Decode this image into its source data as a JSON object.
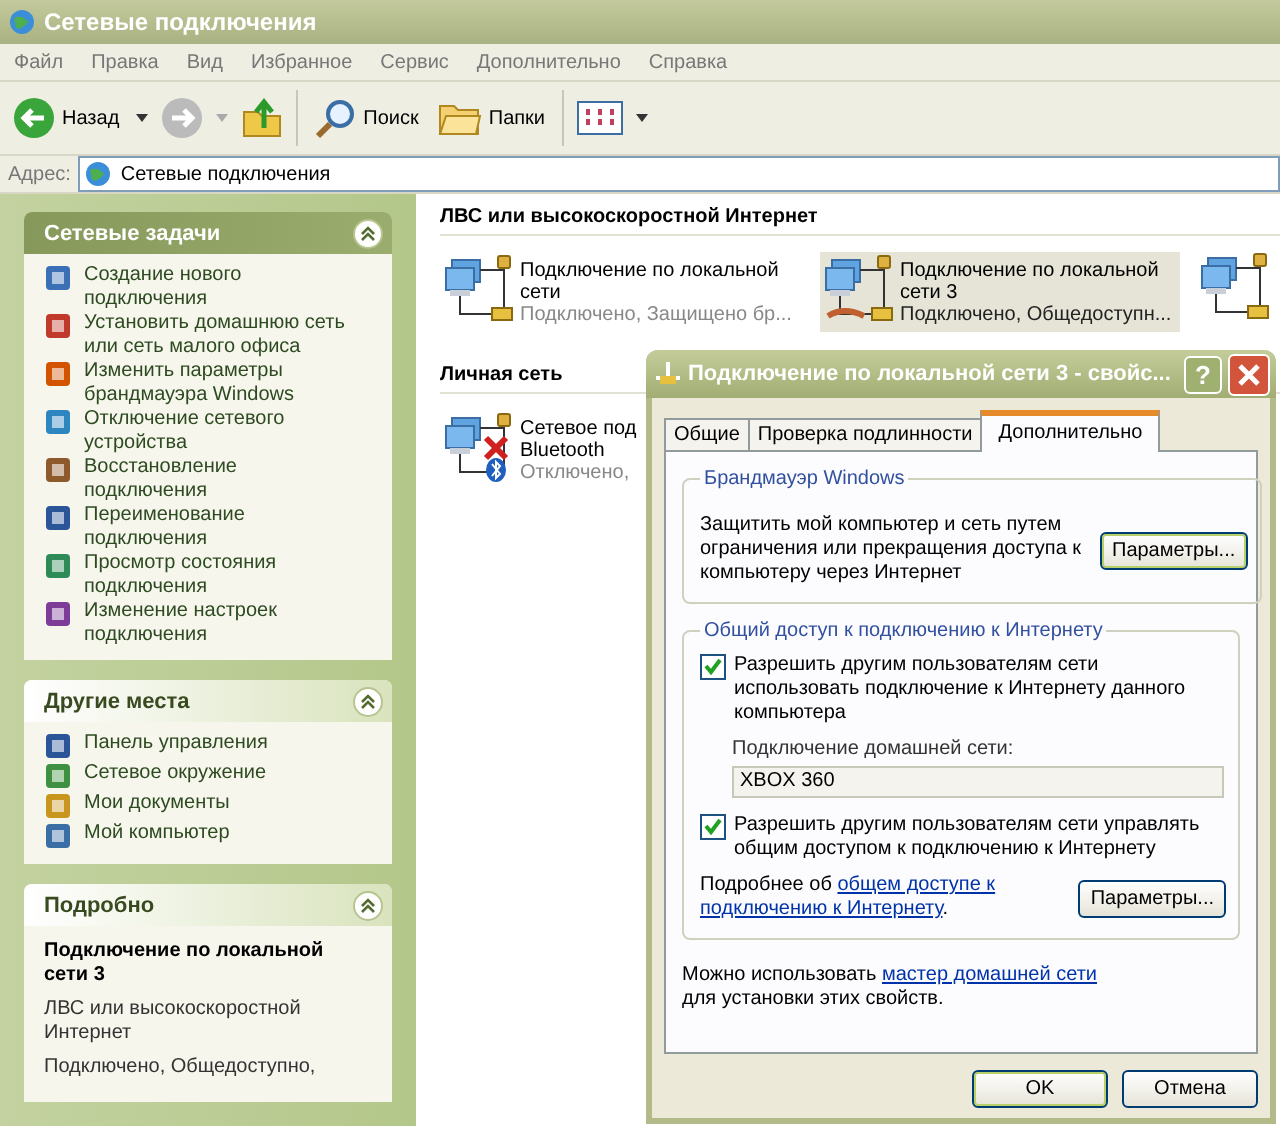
{
  "window": {
    "title": "Сетевые подключения"
  },
  "menu": [
    "Файл",
    "Правка",
    "Вид",
    "Избранное",
    "Сервис",
    "Дополнительно",
    "Справка"
  ],
  "toolbar": {
    "back": "Назад",
    "search": "Поиск",
    "folders": "Папки"
  },
  "address": {
    "label": "Адрес:",
    "value": "Сетевые подключения"
  },
  "task_panels": [
    {
      "title": "Сетевые задачи",
      "kind": "primary",
      "items": [
        "Создание нового подключения",
        "Установить домашнюю сеть или сеть малого офиса",
        "Изменить параметры брандмауэра Windows",
        "Отключение сетевого устройства",
        "Восстановление подключения",
        "Переименование подключения",
        "Просмотр состояния подключения",
        "Изменение настроек подключения"
      ]
    },
    {
      "title": "Другие места",
      "kind": "normal",
      "items": [
        "Панель управления",
        "Сетевое окружение",
        "Мои документы",
        "Мой компьютер"
      ]
    }
  ],
  "details": {
    "title": "Подробно",
    "name": "Подключение по локальной сети 3",
    "type": "ЛВС или высокоскоростной Интернет",
    "status": "Подключено, Общедоступно,"
  },
  "groups": [
    {
      "title": "ЛВС или высокоскоростной Интернет",
      "connections": [
        {
          "kind": "lan",
          "name_lines": [
            "Подключение по локальной",
            "сети"
          ],
          "status": "Подключено, Защищено бр...",
          "connected": true,
          "shared": false,
          "selected": false
        },
        {
          "kind": "lan",
          "name_lines": [
            "Подключение по локальной",
            "сети 3"
          ],
          "status": "Подключено, Общедоступн...",
          "connected": true,
          "shared": true,
          "selected": true
        }
      ]
    },
    {
      "title": "Личная сеть",
      "connections": [
        {
          "kind": "bluetooth",
          "name_lines": [
            "Сетевое под",
            "Bluetooth"
          ],
          "status": "Отключено,",
          "connected": false,
          "shared": false,
          "selected": false
        }
      ]
    }
  ],
  "dialog": {
    "title": "Подключение по локальной сети 3 - свойс...",
    "help": "?",
    "tabs": [
      {
        "label": "Общие",
        "selected": false
      },
      {
        "label": "Проверка подлинности",
        "selected": false
      },
      {
        "label": "Дополнительно",
        "selected": true
      }
    ],
    "firewall": {
      "legend": "Брандмауэр Windows",
      "text": "Защитить мой компьютер и сеть путем ограничения или прекращения доступа к компьютеру через Интернет",
      "button": "Параметры..."
    },
    "sharing": {
      "legend": "Общий доступ к подключению к Интернету",
      "allow": {
        "label": "Разрешить другим пользователям сети использовать подключение к Интернету данного компьютера",
        "checked": true
      },
      "home_label": "Подключение домашней сети:",
      "home_value": "XBOX 360",
      "allow_control": {
        "label": "Разрешить другим пользователям сети управлять общим доступом к подключению к Интернету",
        "checked": true
      },
      "more_text": "Подробнее об",
      "more_link": [
        "общем доступе к",
        "подключению к Интернету"
      ],
      "more_end": ".",
      "button": "Параметры..."
    },
    "wizard": {
      "text": "Можно использовать",
      "link": "мастер домашней сети",
      "text_end": "для установки этих свойств."
    },
    "buttons": [
      "OK",
      "Отмена"
    ]
  }
}
